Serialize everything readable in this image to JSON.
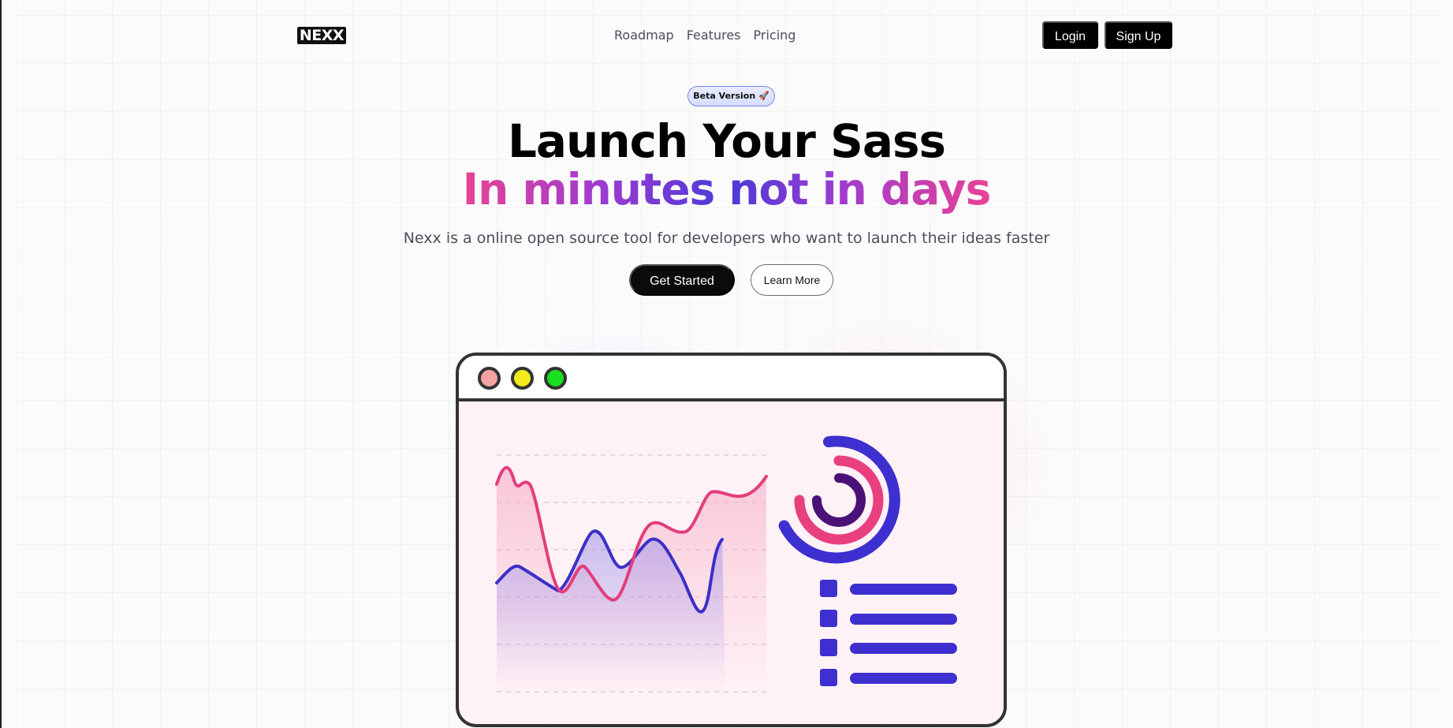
{
  "nav": {
    "logo": "NEXX",
    "links": [
      "Roadmap",
      "Features",
      "Pricing"
    ],
    "login_label": "Login",
    "signup_label": "Sign Up"
  },
  "hero": {
    "badge": "Beta Version 🚀",
    "title": "Launch Your Sass",
    "subtitle_gradient": "In minutes not in days",
    "description": "Nexx is a online open source tool for developers who want to launch their ideas faster",
    "get_started_label": "Get Started",
    "learn_more_label": "Learn More"
  },
  "colors": {
    "accent_pink": "#e84393",
    "accent_indigo": "#4a3ad8",
    "accent_purple": "#a13bd0",
    "dark": "#000000"
  },
  "mockup": {
    "window_dots": [
      "red",
      "yellow",
      "green"
    ],
    "legend_items": 4
  }
}
